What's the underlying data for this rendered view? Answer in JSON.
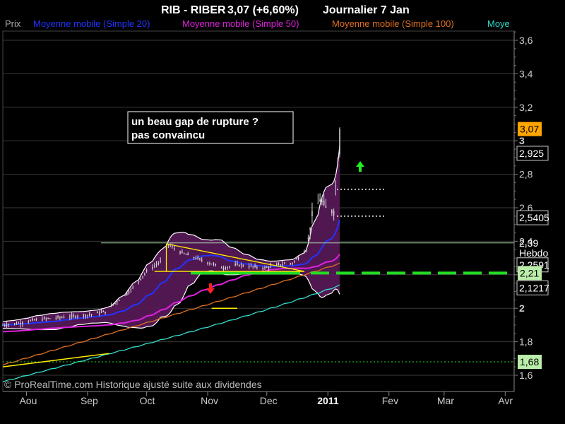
{
  "header": {
    "title": "RIB - RIBER",
    "change": "3,07 (+6,60%)",
    "period": "Journalier  7 Jan"
  },
  "legend": [
    {
      "text": "Prix",
      "color": "#aaaaaa"
    },
    {
      "text": "Moyenne mobile (Simple 20)",
      "color": "#2233ff"
    },
    {
      "text": "Moyenne mobile (Simple 50)",
      "color": "#dd22dd"
    },
    {
      "text": "Moyenne mobile (Simple 100)",
      "color": "#e07020"
    },
    {
      "text": "Moye",
      "color": "#33ddcc"
    }
  ],
  "annotation": {
    "line1": "un beau gap  de rupture ?",
    "line2": "pas convaincu"
  },
  "copyright": "© ProRealTime.com Historique ajusté suite aux dividendes",
  "colors": {
    "background": "#000000",
    "grid": "#3a3a3a",
    "candle": "#d8d8d8",
    "bollinger_fill": "#5a1a5a",
    "ma20": "#2233ff",
    "ma50": "#dd22dd",
    "ma100": "#e07020",
    "ma200": "#33ddcc",
    "support": "#22dd22",
    "last_price_box": "#ffa500"
  },
  "chart_data": {
    "type": "line",
    "title": "RIB - RIBER",
    "y_axis": {
      "ticks": [
        "3,6",
        "3,4",
        "3,2",
        "3",
        "2,8",
        "2,6",
        "2,4",
        "2,2",
        "2",
        "1,8",
        "1,6"
      ],
      "ylim": [
        1.58,
        3.67
      ]
    },
    "x_axis": {
      "ticks": [
        "Aou",
        "Sep",
        "Oct",
        "Nov",
        "Dec",
        "2011",
        "Fev",
        "Mar",
        "Avr"
      ]
    },
    "price_labels": [
      {
        "text": "3,07",
        "value": 3.07,
        "style": "last"
      },
      {
        "text": "2,925",
        "value": 2.925,
        "style": "boxed"
      },
      {
        "text": "2,5405",
        "value": 2.5405,
        "style": "boxed"
      },
      {
        "text": "2,39",
        "value": 2.39,
        "style": "plain"
      },
      {
        "text": "Hebdo",
        "value": 2.33,
        "style": "plain"
      },
      {
        "text": "2,2591",
        "value": 2.2591,
        "style": "boxed"
      },
      {
        "text": "2,21",
        "value": 2.21,
        "style": "green"
      },
      {
        "text": "2,1217",
        "value": 2.1217,
        "style": "boxed"
      },
      {
        "text": "1,68",
        "value": 1.68,
        "style": "green"
      }
    ],
    "horizontal_lines": [
      {
        "name": "resistance-2,39",
        "value": 2.39
      },
      {
        "name": "support-2,21",
        "value": 2.21
      },
      {
        "name": "support-1,68",
        "value": 1.68
      }
    ],
    "price_path": [
      [
        "2010-07-20",
        1.9
      ],
      [
        "2010-07-28",
        1.91
      ],
      [
        "2010-08-05",
        1.93
      ],
      [
        "2010-08-13",
        1.94
      ],
      [
        "2010-08-23",
        1.95
      ],
      [
        "2010-09-01",
        1.96
      ],
      [
        "2010-09-10",
        1.98
      ],
      [
        "2010-09-17",
        2.05
      ],
      [
        "2010-09-24",
        2.12
      ],
      [
        "2010-10-01",
        2.22
      ],
      [
        "2010-10-08",
        2.28
      ],
      [
        "2010-10-12",
        2.38
      ],
      [
        "2010-10-19",
        2.33
      ],
      [
        "2010-10-26",
        2.3
      ],
      [
        "2010-11-02",
        2.27
      ],
      [
        "2010-11-09",
        2.24
      ],
      [
        "2010-11-16",
        2.26
      ],
      [
        "2010-11-23",
        2.25
      ],
      [
        "2010-11-30",
        2.24
      ],
      [
        "2010-12-07",
        2.26
      ],
      [
        "2010-12-14",
        2.27
      ],
      [
        "2010-12-21",
        2.35
      ],
      [
        "2010-12-24",
        2.55
      ],
      [
        "2010-12-28",
        2.65
      ],
      [
        "2010-12-31",
        2.6
      ],
      [
        "2011-01-04",
        2.58
      ],
      [
        "2011-01-06",
        2.88
      ],
      [
        "2011-01-07",
        3.07
      ]
    ]
  }
}
